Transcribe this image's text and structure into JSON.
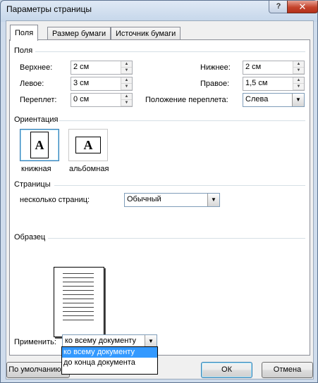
{
  "window": {
    "title": "Параметры страницы",
    "help_label": "?",
    "close_label": "✕"
  },
  "tabs": [
    {
      "label": "Поля"
    },
    {
      "label": "Размер бумаги"
    },
    {
      "label": "Источник бумаги"
    }
  ],
  "margins_section": {
    "title": "Поля",
    "top_label": "Верхнее:",
    "top_value": "2 см",
    "bottom_label": "Нижнее:",
    "bottom_value": "2 см",
    "left_label": "Левое:",
    "left_value": "3 см",
    "right_label": "Правое:",
    "right_value": "1,5 см",
    "gutter_label": "Переплет:",
    "gutter_value": "0 см",
    "gutter_pos_label": "Положение переплета:",
    "gutter_pos_value": "Слева"
  },
  "orientation_section": {
    "title": "Ориентация",
    "portrait_label": "книжная",
    "landscape_label": "альбомная",
    "icon_letter": "A"
  },
  "pages_section": {
    "title": "Страницы",
    "multiple_label": "несколько страниц:",
    "multiple_value": "Обычный"
  },
  "preview_section": {
    "title": "Образец"
  },
  "apply": {
    "label": "Применить:",
    "value": "ко всему документу",
    "options": [
      "ко всему документу",
      "до конца документа"
    ]
  },
  "buttons": {
    "default": "По умолчанию...",
    "ok": "ОК",
    "cancel": "Отмена"
  }
}
